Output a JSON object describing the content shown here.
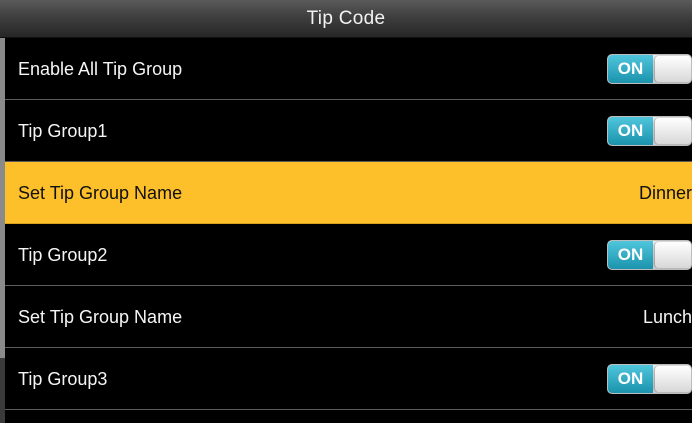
{
  "header": {
    "title": "Tip Code"
  },
  "rows": [
    {
      "label": "Enable All Tip Group",
      "toggle": "ON"
    },
    {
      "label": "Tip Group1",
      "toggle": "ON"
    },
    {
      "label": "Set Tip Group Name",
      "value": "Dinner"
    },
    {
      "label": "Tip Group2",
      "toggle": "ON"
    },
    {
      "label": "Set Tip Group Name",
      "value": "Lunch"
    },
    {
      "label": "Tip Group3",
      "toggle": "ON"
    }
  ],
  "colors": {
    "selected_row": "#fdc02a",
    "toggle_on": "#1b93ad",
    "background": "#000000"
  }
}
